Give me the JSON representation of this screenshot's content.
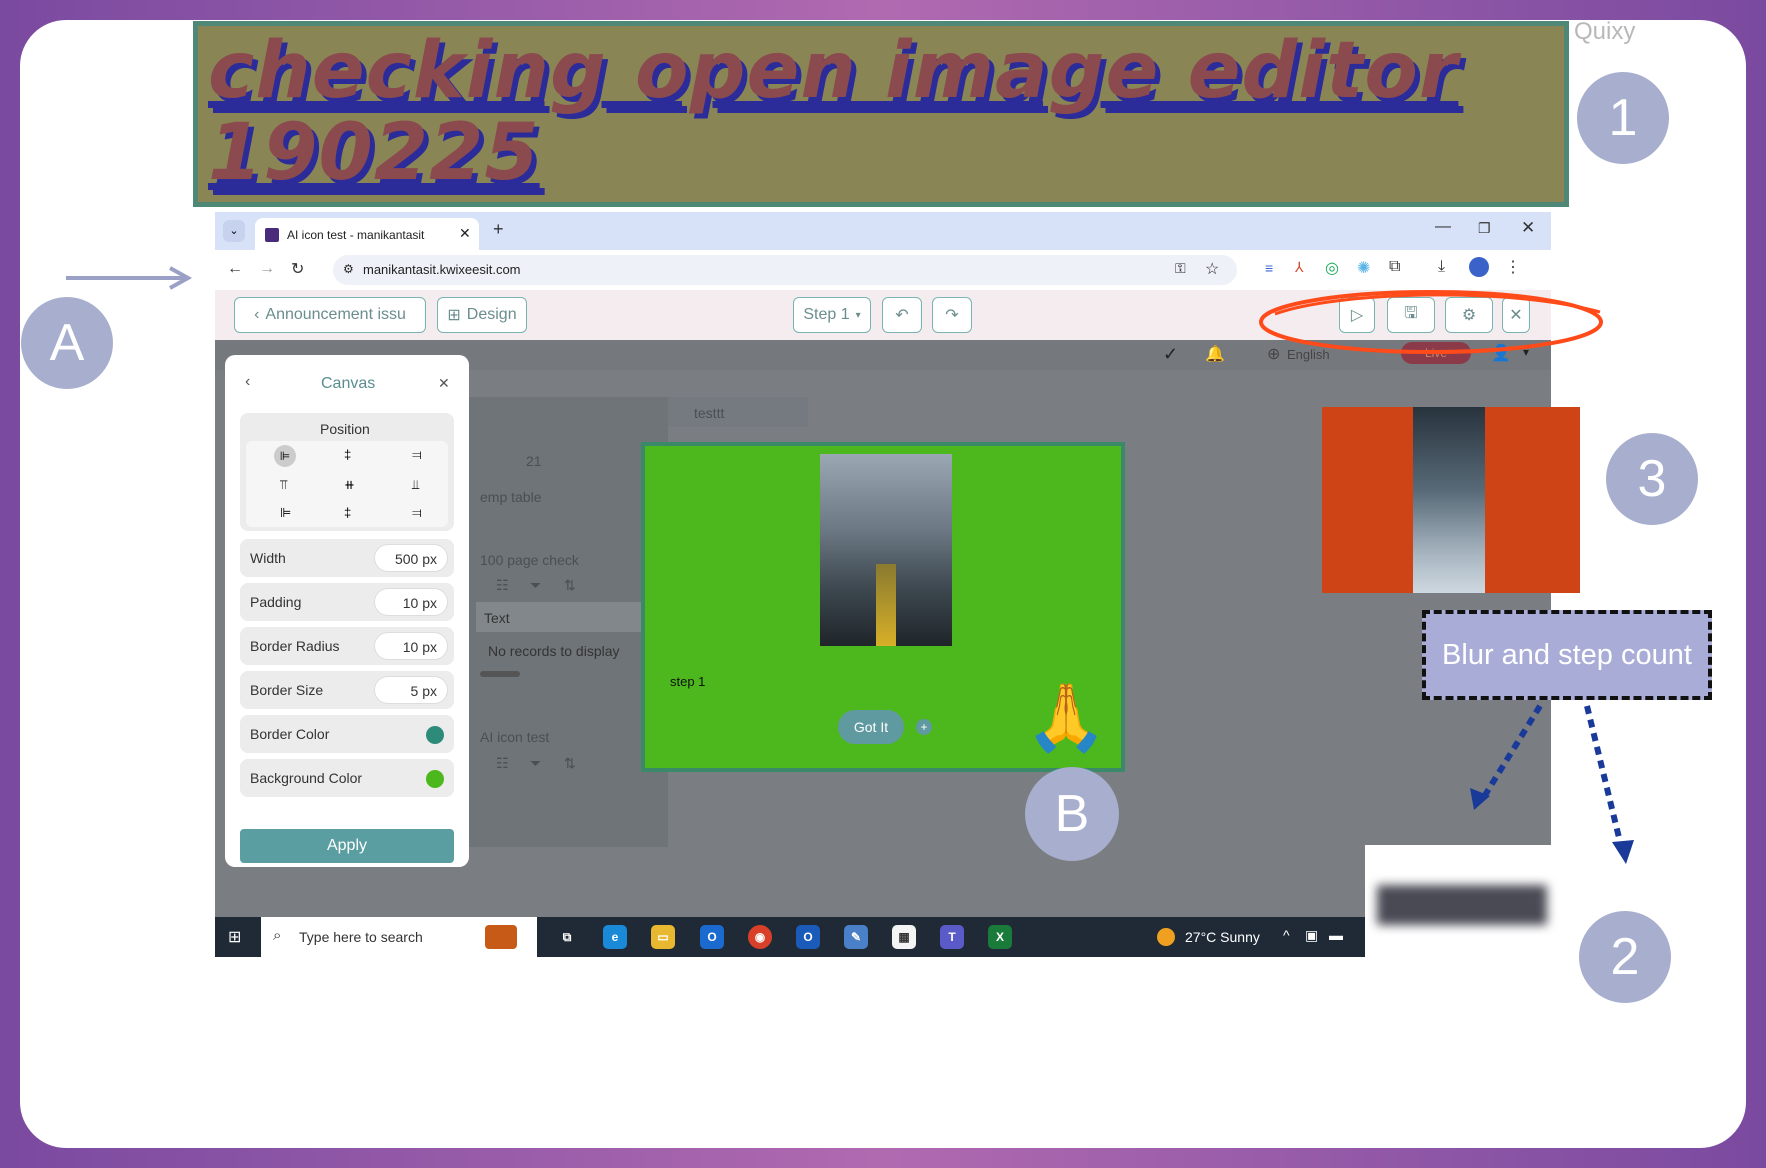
{
  "quixy_label": "Quixy",
  "title": "checking open image editor 190225",
  "badges": {
    "a": "A",
    "one": "1",
    "two": "2",
    "three": "3",
    "b": "B"
  },
  "annotation_label": "Blur and step count",
  "browser": {
    "tab_title": "AI icon test - manikantasit",
    "url": "manikantasit.kwixeesit.com"
  },
  "app_toolbar": {
    "back_label": "Announcement issu",
    "design_label": "Design",
    "step_label": "Step 1"
  },
  "app_header": {
    "language": "English",
    "status": "Live"
  },
  "canvas_panel": {
    "title": "Canvas",
    "position_label": "Position",
    "rows": [
      {
        "label": "Width",
        "value": "500 px"
      },
      {
        "label": "Padding",
        "value": "10 px"
      },
      {
        "label": "Border Radius",
        "value": "10 px"
      },
      {
        "label": "Border Size",
        "value": "5 px"
      }
    ],
    "color_rows": [
      {
        "label": "Border Color",
        "color": "#2e8b7a"
      },
      {
        "label": "Background Color",
        "color": "#4cb81e"
      }
    ],
    "apply_label": "Apply"
  },
  "background_app": {
    "tab_test": "test",
    "tab_testtt": "testtt",
    "number": "21",
    "emp_table": "emp table",
    "page_check": "100 page check",
    "col_text": "Text",
    "no_records": "No records to display",
    "ai_icon_test": "AI icon test"
  },
  "popup": {
    "step_text": "step 1",
    "got_it_label": "Got It",
    "plus_label": "+",
    "emoji": "🙏"
  },
  "taskbar": {
    "search_placeholder": "Type here to search",
    "weather": "27°C  Sunny"
  }
}
